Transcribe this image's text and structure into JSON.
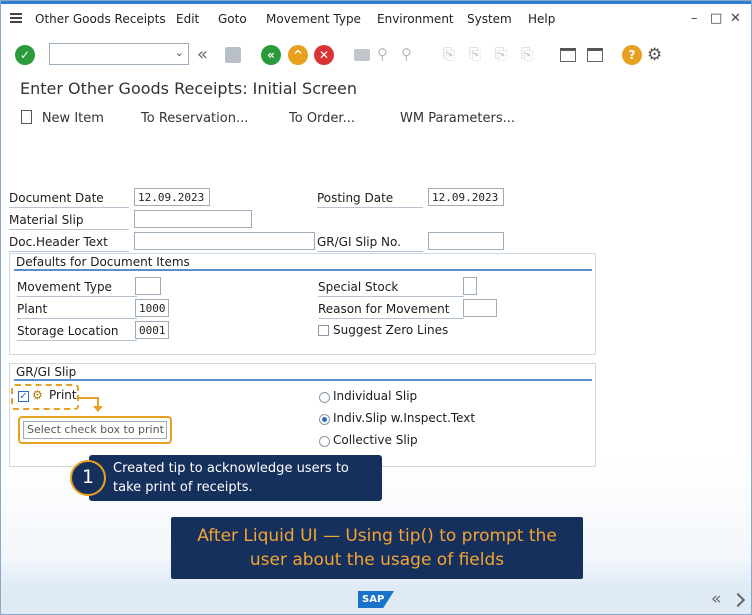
{
  "menu": {
    "items": [
      "Other Goods Receipts",
      "Edit",
      "Goto",
      "Movement Type",
      "Environment",
      "System",
      "Help"
    ]
  },
  "window_controls": {
    "minimize": "–",
    "maximize": "□",
    "close": "✕"
  },
  "toolbar": {
    "command_value": "",
    "icons": [
      "enter-icon",
      "command-field",
      "back-arrows-icon",
      "save-icon",
      "back-icon",
      "exit-icon",
      "cancel-icon",
      "print-icon",
      "find-icon",
      "first-page-icon",
      "prev-page-icon",
      "next-page-icon",
      "last-page-icon",
      "create-session-icon",
      "shortcut-icon",
      "help-icon",
      "settings-icon"
    ]
  },
  "page": {
    "title": "Enter Other Goods Receipts: Initial Screen"
  },
  "app_toolbar": {
    "new_item": "New Item",
    "to_reservation": "To Reservation...",
    "to_order": "To Order...",
    "wm_parameters": "WM Parameters..."
  },
  "header_fields": {
    "document_date_label": "Document Date",
    "document_date": "12.09.2023",
    "posting_date_label": "Posting Date",
    "posting_date": "12.09.2023",
    "material_slip_label": "Material Slip",
    "material_slip": "",
    "doc_header_text_label": "Doc.Header Text",
    "doc_header_text": "",
    "gr_gi_slip_no_label": "GR/GI Slip No.",
    "gr_gi_slip_no": ""
  },
  "defaults": {
    "title": "Defaults for Document Items",
    "movement_type_label": "Movement Type",
    "movement_type": "",
    "special_stock_label": "Special Stock",
    "special_stock": "",
    "plant_label": "Plant",
    "plant": "1000",
    "reason_label": "Reason for Movement",
    "reason": "",
    "storage_location_label": "Storage Location",
    "storage_location": "0001",
    "suggest_zero_label": "Suggest Zero Lines"
  },
  "slip": {
    "title": "GR/GI Slip",
    "print_label": "Print",
    "tip_placeholder": "Select check box to print",
    "individual_slip": "Individual Slip",
    "indiv_inspect": "Indiv.Slip w.Inspect.Text",
    "collective_slip": "Collective Slip"
  },
  "callout": {
    "number": "1",
    "text": "Created tip to acknowledge users to take print of receipts."
  },
  "banner": {
    "text": "After Liquid UI — Using tip() to prompt the user about the usage of fields"
  },
  "footer": {
    "brand": "SAP",
    "nav": "«"
  },
  "colors": {
    "accent_orange": "#e8a020",
    "callout_bg": "#16305e",
    "banner_text": "#f3a431",
    "sap_blue": "#1a73c8"
  }
}
